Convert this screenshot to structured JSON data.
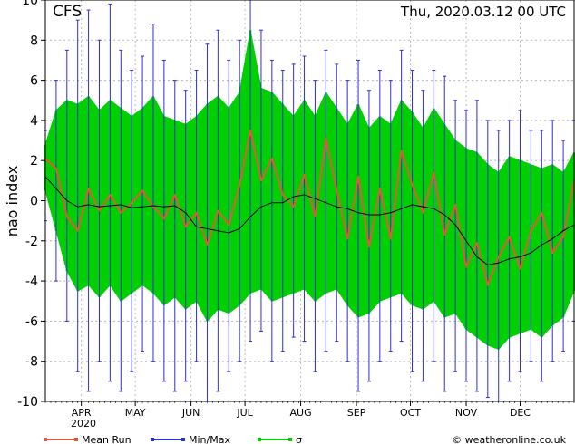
{
  "header": {
    "model": "CFS",
    "timestamp": "Thu, 2020.03.12   00 UTC"
  },
  "axes": {
    "ylabel": "nao index",
    "year_label": "2020"
  },
  "legend": {
    "mean_label": "Mean Run",
    "minmax_label": "Min/Max",
    "sigma_label": "σ"
  },
  "footer": {
    "copyright": "© weatheronline.co.uk"
  },
  "colors": {
    "mean": "#e05a3a",
    "minmax": "#2f2fd6",
    "sigma": "#00d000",
    "ensemble": "#000000",
    "grid": "#b8b8b8"
  },
  "chart_data": {
    "type": "line",
    "title": "CFS",
    "subtitle": "Thu, 2020.03.12   00 UTC",
    "xlabel": "",
    "ylabel": "nao index",
    "x_range": [
      "2020-03-12",
      "2020-12-31"
    ],
    "ylim": [
      -10,
      10
    ],
    "yticks": [
      -10,
      -8,
      -6,
      -4,
      -2,
      0,
      2,
      4,
      6,
      8,
      10
    ],
    "xticks": [
      "APR",
      "MAY",
      "JUN",
      "JUL",
      "AUG",
      "SEP",
      "OCT",
      "NOV",
      "DEC"
    ],
    "xtick_dates": [
      "2020-04-01",
      "2020-05-01",
      "2020-06-01",
      "2020-07-01",
      "2020-08-01",
      "2020-09-01",
      "2020-10-01",
      "2020-11-01",
      "2020-12-01"
    ],
    "grid": true,
    "legend_position": "bottom",
    "series": [
      {
        "name": "Mean Run",
        "dates": [
          "2020-03-12",
          "2020-03-18",
          "2020-03-24",
          "2020-03-30",
          "2020-04-05",
          "2020-04-11",
          "2020-04-17",
          "2020-04-23",
          "2020-04-29",
          "2020-05-05",
          "2020-05-11",
          "2020-05-17",
          "2020-05-23",
          "2020-05-29",
          "2020-06-04",
          "2020-06-10",
          "2020-06-16",
          "2020-06-22",
          "2020-06-28",
          "2020-07-04",
          "2020-07-10",
          "2020-07-16",
          "2020-07-22",
          "2020-07-28",
          "2020-08-03",
          "2020-08-09",
          "2020-08-15",
          "2020-08-21",
          "2020-08-27",
          "2020-09-02",
          "2020-09-08",
          "2020-09-14",
          "2020-09-20",
          "2020-09-26",
          "2020-10-02",
          "2020-10-08",
          "2020-10-14",
          "2020-10-20",
          "2020-10-26",
          "2020-11-01",
          "2020-11-07",
          "2020-11-13",
          "2020-11-19",
          "2020-11-25",
          "2020-12-01",
          "2020-12-07",
          "2020-12-13",
          "2020-12-19",
          "2020-12-25",
          "2020-12-31"
        ],
        "values": [
          2.1,
          1.6,
          -0.8,
          -1.5,
          0.6,
          -0.5,
          0.3,
          -0.6,
          -0.1,
          0.5,
          -0.3,
          -0.9,
          0.3,
          -1.3,
          -0.6,
          -2.2,
          -0.5,
          -1.2,
          0.8,
          3.5,
          1.0,
          2.1,
          0.3,
          -0.3,
          1.3,
          -0.8,
          3.1,
          0.5,
          -1.9,
          1.2,
          -2.3,
          0.6,
          -1.9,
          2.5,
          0.8,
          -0.6,
          1.4,
          -1.7,
          -0.2,
          -3.3,
          -2.1,
          -4.2,
          -2.8,
          -1.8,
          -3.4,
          -1.5,
          -0.6,
          -2.6,
          -1.8,
          1.0
        ]
      },
      {
        "name": "Min/Max",
        "dates": [
          "2020-03-12",
          "2020-03-18",
          "2020-03-24",
          "2020-03-30",
          "2020-04-05",
          "2020-04-11",
          "2020-04-17",
          "2020-04-23",
          "2020-04-29",
          "2020-05-05",
          "2020-05-11",
          "2020-05-17",
          "2020-05-23",
          "2020-05-29",
          "2020-06-04",
          "2020-06-10",
          "2020-06-16",
          "2020-06-22",
          "2020-06-28",
          "2020-07-04",
          "2020-07-10",
          "2020-07-16",
          "2020-07-22",
          "2020-07-28",
          "2020-08-03",
          "2020-08-09",
          "2020-08-15",
          "2020-08-21",
          "2020-08-27",
          "2020-09-02",
          "2020-09-08",
          "2020-09-14",
          "2020-09-20",
          "2020-09-26",
          "2020-10-02",
          "2020-10-08",
          "2020-10-14",
          "2020-10-20",
          "2020-10-26",
          "2020-11-01",
          "2020-11-07",
          "2020-11-13",
          "2020-11-19",
          "2020-11-25",
          "2020-12-01",
          "2020-12-07",
          "2020-12-13",
          "2020-12-19",
          "2020-12-25",
          "2020-12-31"
        ],
        "max": [
          3.5,
          6.0,
          7.5,
          9.0,
          9.5,
          8.0,
          9.8,
          7.5,
          6.5,
          7.2,
          8.8,
          7.0,
          6.0,
          5.5,
          6.5,
          7.8,
          8.5,
          7.0,
          8.0,
          10.0,
          8.5,
          7.0,
          6.5,
          6.8,
          7.2,
          6.0,
          7.5,
          6.8,
          6.0,
          7.0,
          5.5,
          6.5,
          6.0,
          7.5,
          6.5,
          5.5,
          6.5,
          6.2,
          5.0,
          4.5,
          5.0,
          4.0,
          3.5,
          4.0,
          4.5,
          3.5,
          3.5,
          4.0,
          3.0,
          4.0
        ],
        "min": [
          -1.0,
          -4.0,
          -6.0,
          -8.5,
          -9.5,
          -8.0,
          -9.0,
          -9.5,
          -8.5,
          -7.5,
          -8.0,
          -9.0,
          -9.5,
          -9.0,
          -8.0,
          -10.0,
          -9.5,
          -8.5,
          -8.0,
          -7.0,
          -6.5,
          -8.0,
          -7.5,
          -6.8,
          -7.0,
          -8.5,
          -7.5,
          -7.0,
          -8.0,
          -9.5,
          -9.0,
          -8.0,
          -7.5,
          -7.0,
          -8.5,
          -9.0,
          -8.0,
          -9.5,
          -8.5,
          -9.0,
          -9.5,
          -9.8,
          -10.0,
          -9.0,
          -8.5,
          -8.0,
          -9.0,
          -8.0,
          -7.5,
          -6.0
        ]
      },
      {
        "name": "σ",
        "dates": [
          "2020-03-12",
          "2020-03-18",
          "2020-03-24",
          "2020-03-30",
          "2020-04-05",
          "2020-04-11",
          "2020-04-17",
          "2020-04-23",
          "2020-04-29",
          "2020-05-05",
          "2020-05-11",
          "2020-05-17",
          "2020-05-23",
          "2020-05-29",
          "2020-06-04",
          "2020-06-10",
          "2020-06-16",
          "2020-06-22",
          "2020-06-28",
          "2020-07-04",
          "2020-07-10",
          "2020-07-16",
          "2020-07-22",
          "2020-07-28",
          "2020-08-03",
          "2020-08-09",
          "2020-08-15",
          "2020-08-21",
          "2020-08-27",
          "2020-09-02",
          "2020-09-08",
          "2020-09-14",
          "2020-09-20",
          "2020-09-26",
          "2020-10-02",
          "2020-10-08",
          "2020-10-14",
          "2020-10-20",
          "2020-10-26",
          "2020-11-01",
          "2020-11-07",
          "2020-11-13",
          "2020-11-19",
          "2020-11-25",
          "2020-12-01",
          "2020-12-07",
          "2020-12-13",
          "2020-12-19",
          "2020-12-25",
          "2020-12-31"
        ],
        "upper": [
          2.8,
          4.5,
          5.0,
          4.8,
          5.2,
          4.5,
          5.0,
          4.6,
          4.2,
          4.6,
          5.2,
          4.2,
          4.0,
          3.8,
          4.2,
          4.8,
          5.2,
          4.6,
          5.4,
          8.5,
          5.6,
          5.4,
          4.8,
          4.2,
          5.0,
          4.2,
          5.4,
          4.6,
          3.8,
          4.8,
          3.6,
          4.2,
          3.8,
          5.0,
          4.4,
          3.6,
          4.6,
          3.8,
          3.0,
          2.6,
          2.4,
          1.8,
          1.4,
          2.2,
          2.0,
          1.8,
          1.6,
          1.8,
          1.4,
          2.4
        ],
        "lower": [
          0.5,
          -1.5,
          -3.5,
          -4.5,
          -4.2,
          -4.8,
          -4.2,
          -5.0,
          -4.6,
          -4.2,
          -4.6,
          -5.2,
          -4.8,
          -5.4,
          -5.0,
          -6.0,
          -5.4,
          -5.6,
          -5.2,
          -4.6,
          -4.4,
          -5.0,
          -4.8,
          -4.6,
          -4.4,
          -5.0,
          -4.6,
          -4.4,
          -5.2,
          -5.8,
          -5.6,
          -5.0,
          -4.8,
          -4.6,
          -5.2,
          -5.4,
          -5.0,
          -5.8,
          -5.6,
          -6.4,
          -6.8,
          -7.2,
          -7.4,
          -6.8,
          -6.6,
          -6.4,
          -6.8,
          -6.2,
          -5.8,
          -4.5
        ]
      },
      {
        "name": "",
        "dates": [
          "2020-03-12",
          "2020-03-18",
          "2020-03-24",
          "2020-03-30",
          "2020-04-05",
          "2020-04-11",
          "2020-04-17",
          "2020-04-23",
          "2020-04-29",
          "2020-05-05",
          "2020-05-11",
          "2020-05-17",
          "2020-05-23",
          "2020-05-29",
          "2020-06-04",
          "2020-06-10",
          "2020-06-16",
          "2020-06-22",
          "2020-06-28",
          "2020-07-04",
          "2020-07-10",
          "2020-07-16",
          "2020-07-22",
          "2020-07-28",
          "2020-08-03",
          "2020-08-09",
          "2020-08-15",
          "2020-08-21",
          "2020-08-27",
          "2020-09-02",
          "2020-09-08",
          "2020-09-14",
          "2020-09-20",
          "2020-09-26",
          "2020-10-02",
          "2020-10-08",
          "2020-10-14",
          "2020-10-20",
          "2020-10-26",
          "2020-11-01",
          "2020-11-07",
          "2020-11-13",
          "2020-11-19",
          "2020-11-25",
          "2020-12-01",
          "2020-12-07",
          "2020-12-13",
          "2020-12-19",
          "2020-12-25",
          "2020-12-31"
        ],
        "values": [
          1.2,
          0.6,
          0.0,
          -0.3,
          -0.2,
          -0.3,
          -0.25,
          -0.2,
          -0.35,
          -0.3,
          -0.25,
          -0.3,
          -0.25,
          -0.6,
          -1.3,
          -1.4,
          -1.5,
          -1.6,
          -1.4,
          -0.8,
          -0.3,
          -0.1,
          -0.1,
          0.2,
          0.3,
          0.1,
          -0.1,
          -0.3,
          -0.4,
          -0.6,
          -0.7,
          -0.7,
          -0.6,
          -0.4,
          -0.2,
          -0.3,
          -0.4,
          -0.7,
          -1.2,
          -2.0,
          -2.8,
          -3.2,
          -3.1,
          -2.9,
          -2.8,
          -2.6,
          -2.2,
          -1.9,
          -1.5,
          -1.2
        ]
      }
    ]
  }
}
